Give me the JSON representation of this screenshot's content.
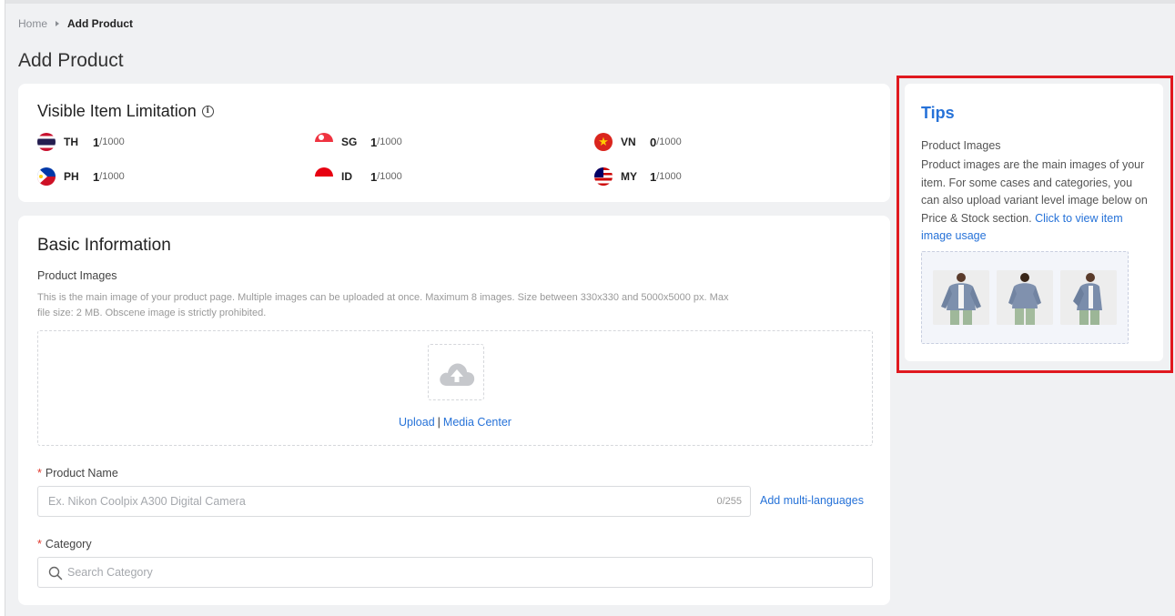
{
  "breadcrumb": {
    "home": "Home",
    "current": "Add Product"
  },
  "page_title": "Add Product",
  "limitation": {
    "title": "Visible Item Limitation",
    "countries": [
      {
        "code": "TH",
        "count": "1",
        "max": "/1000",
        "flag": "thailand-flag-icon"
      },
      {
        "code": "SG",
        "count": "1",
        "max": "/1000",
        "flag": "singapore-flag-icon"
      },
      {
        "code": "VN",
        "count": "0",
        "max": "/1000",
        "flag": "vietnam-flag-icon"
      },
      {
        "code": "PH",
        "count": "1",
        "max": "/1000",
        "flag": "philippines-flag-icon"
      },
      {
        "code": "ID",
        "count": "1",
        "max": "/1000",
        "flag": "indonesia-flag-icon"
      },
      {
        "code": "MY",
        "count": "1",
        "max": "/1000",
        "flag": "malaysia-flag-icon"
      }
    ]
  },
  "basic": {
    "title": "Basic Information",
    "images_label": "Product Images",
    "images_hint": "This is the main image of your product page. Multiple images can be uploaded at once. Maximum 8 images. Size between 330x330 and 5000x5000 px. Max file size: 2 MB. Obscene image is strictly prohibited.",
    "upload_label": "Upload",
    "separator": "|",
    "media_center_label": "Media Center",
    "required_mark": "*",
    "name_label": "Product Name",
    "name_placeholder": "Ex. Nikon Coolpix A300 Digital Camera",
    "name_counter": "0/255",
    "multi_lang_label": "Add multi-languages",
    "category_label": "Category",
    "category_placeholder": "Search Category"
  },
  "tips": {
    "title": "Tips",
    "subtitle": "Product Images",
    "body": "Product images are the main images of your item. For some cases and categories, you can also upload variant level image below on Price & Stock section.",
    "link": "Click to view item image usage"
  },
  "colors": {
    "accent": "#2672d8",
    "highlight": "#e0191f",
    "required": "#e0362a"
  }
}
